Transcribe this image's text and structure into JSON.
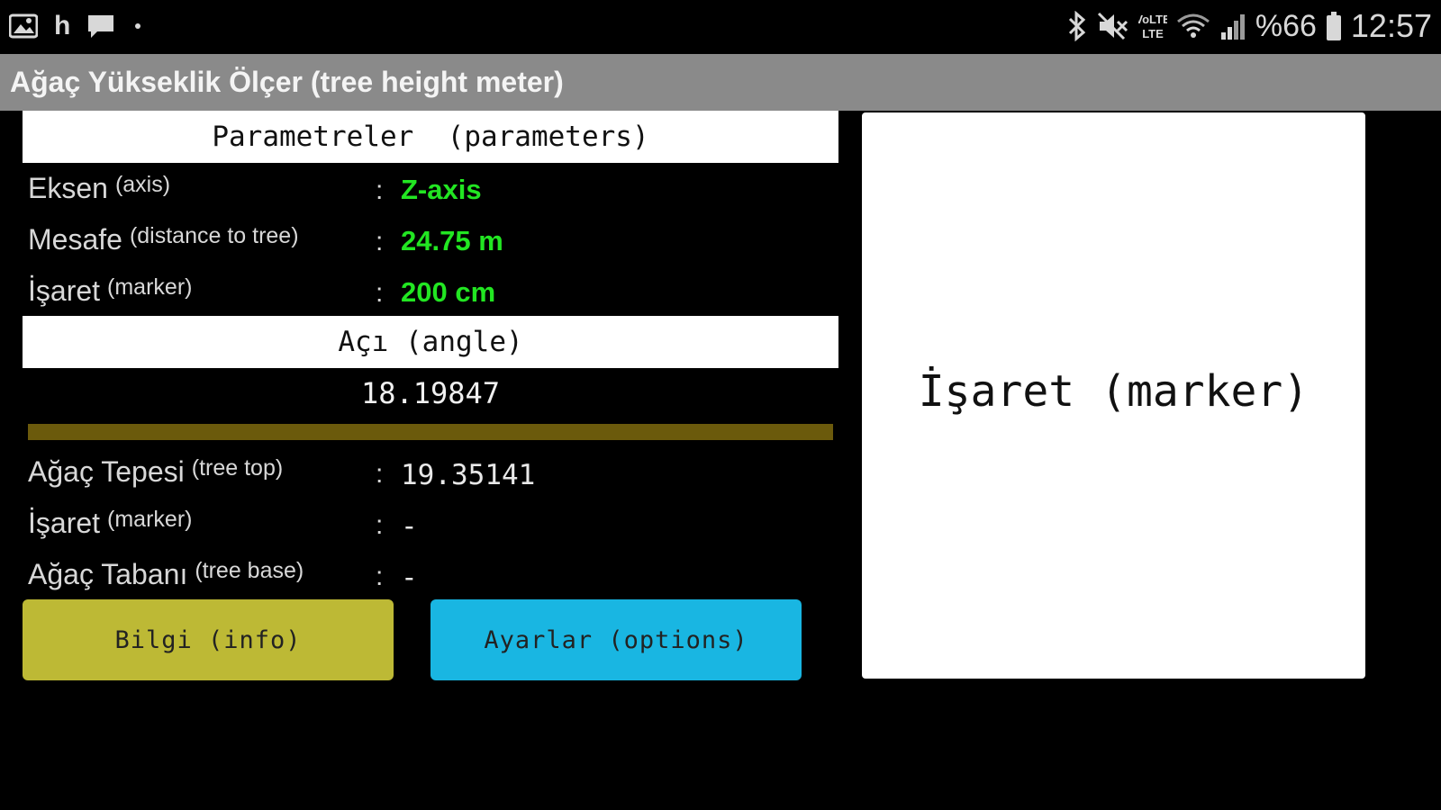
{
  "status_bar": {
    "notification_letter": "h",
    "battery_text": "%66",
    "time": "12:57",
    "volte_label": "VoLTE",
    "icons": [
      "image-icon",
      "chat-icon",
      "bluetooth-icon",
      "mute-icon",
      "volte-icon",
      "wifi-icon",
      "signal-icon",
      "battery-icon"
    ]
  },
  "app": {
    "title": "Ağaç Yükseklik Ölçer (tree height meter)"
  },
  "parameters": {
    "header": "Parametreler  (parameters)",
    "rows": [
      {
        "label": "Eksen",
        "sub": "(axis)",
        "colon": ":",
        "value": "Z-axis"
      },
      {
        "label": "Mesafe",
        "sub": "(distance to tree)",
        "colon": ":",
        "value": "24.75 m"
      },
      {
        "label": "İşaret",
        "sub": "(marker)",
        "colon": ":",
        "value": "200 cm"
      }
    ],
    "value_color": "#22e622"
  },
  "angle": {
    "header": "Açı (angle)",
    "value": "18.19847",
    "level_percent": 100
  },
  "results": {
    "rows": [
      {
        "label": "Ağaç Tepesi",
        "sub": "(tree top)",
        "colon": ":",
        "value": "19.35141"
      },
      {
        "label": "İşaret",
        "sub": "(marker)",
        "colon": ":",
        "value": "-"
      },
      {
        "label": "Ağaç Tabanı",
        "sub": "(tree base)",
        "colon": ":",
        "value": "-"
      }
    ]
  },
  "buttons": {
    "info_label": "Bilgi (info)",
    "options_label": "Ayarlar (options)",
    "info_color": "#bdb935",
    "options_color": "#19b6e2"
  },
  "marker_panel": {
    "text": "İşaret (marker)"
  }
}
